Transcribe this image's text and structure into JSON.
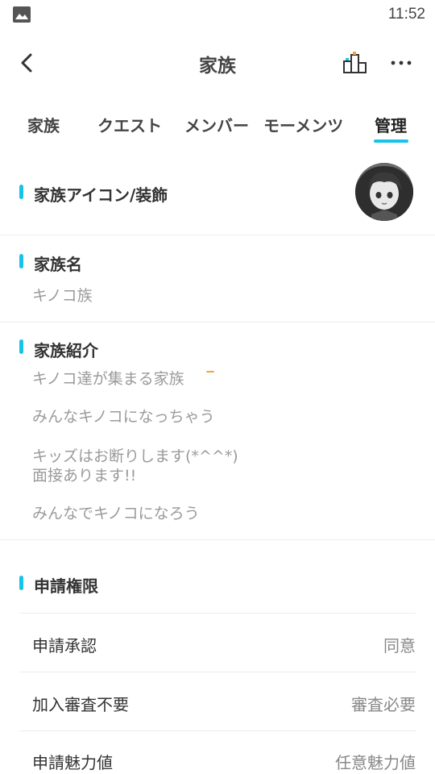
{
  "status_bar": {
    "time": "11:52",
    "image_icon": "image-icon"
  },
  "header": {
    "title": "家族",
    "back_icon": "chevron-left-icon",
    "rank_icon": "podium-icon",
    "more_icon": "more-dots-icon"
  },
  "tabs": [
    {
      "label": "家族"
    },
    {
      "label": "クエスト"
    },
    {
      "label": "メンバー"
    },
    {
      "label": "モーメンツ"
    },
    {
      "label": "管理",
      "active": true
    }
  ],
  "sections": {
    "icon_deco": {
      "title": "家族アイコン/装飾"
    },
    "family_name": {
      "title": "家族名",
      "value": "キノコ族"
    },
    "intro": {
      "title": "家族紹介",
      "lines": [
        "キノコ達が集まる家族",
        "みんなキノコになっちゃう",
        "キッズはお断りします(*^^*)",
        "面接あります!!",
        "みんなでキノコになろう"
      ]
    },
    "apply": {
      "title": "申請権限"
    }
  },
  "settings_rows": [
    {
      "label": "申請承認",
      "value": "同意"
    },
    {
      "label": "加入審査不要",
      "value": "審査必要"
    },
    {
      "label": "申請魅力値",
      "value": "任意魅力値"
    }
  ],
  "colors": {
    "accent": "#17c3e8",
    "text": "#333333",
    "muted": "#9a9a9a"
  }
}
